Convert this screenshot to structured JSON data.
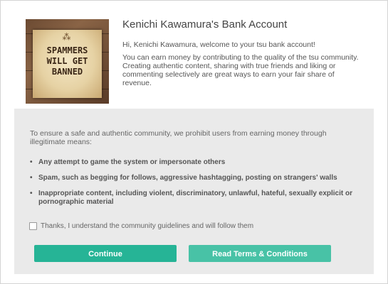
{
  "header": {
    "title": "Kenichi Kawamura's Bank Account",
    "greeting": "Hi, Kenichi Kawamura, welcome to your tsu bank account!",
    "intro": "You can earn money by contributing to the quality of the tsu community. Creating authentic content, sharing with true friends and liking or commenting selectively are great ways to earn your fair share of revenue."
  },
  "poster": {
    "text": "SPAMMERS\nWILL GET\nBANNED"
  },
  "policy": {
    "intro": "To ensure a safe and authentic community, we prohibit users from earning money through illegitimate means:",
    "rules": [
      "Any attempt to game the system or impersonate others",
      "Spam, such as begging for follows, aggressive hashtagging, posting on strangers' walls",
      "Inappropriate content, including violent, discriminatory, unlawful, hateful, sexually explicit or pornographic material"
    ],
    "agree_label": "Thanks, I understand the community guidelines and will follow them",
    "agree_checked": false
  },
  "buttons": {
    "continue": "Continue",
    "terms": "Read Terms & Conditions"
  },
  "colors": {
    "button_primary": "#26b496",
    "button_secondary": "#48c2a6",
    "panel_bg": "#eaeaea"
  }
}
